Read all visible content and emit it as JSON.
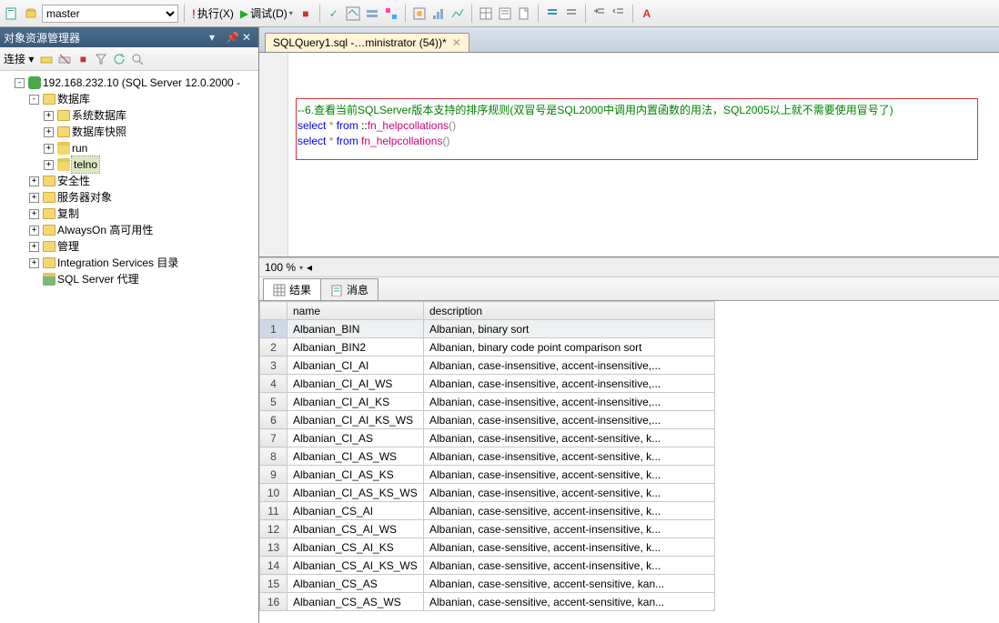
{
  "toolbar": {
    "db_selected": "master",
    "execute": "执行(X)",
    "debug": "调试(D)"
  },
  "sidebar": {
    "title": "对象资源管理器",
    "connect_label": "连接 ▾",
    "server": "192.168.232.10 (SQL Server 12.0.2000 -",
    "nodes": {
      "databases": "数据库",
      "sys_db": "系统数据库",
      "db_snap": "数据库快照",
      "run": "run",
      "telno": "telno",
      "security": "安全性",
      "server_obj": "服务器对象",
      "replication": "复制",
      "alwayson": "AlwaysOn 高可用性",
      "manage": "管理",
      "isc": "Integration Services 目录",
      "agent": "SQL Server 代理"
    }
  },
  "tab": {
    "label": "SQLQuery1.sql -…ministrator (54))*"
  },
  "code": {
    "l1": "--6.查看当前SQLServer版本支持的排序规则(双冒号是SQL2000中调用内置函数的用法，SQL2005以上就不需要使用冒号了)",
    "l2a": "select",
    "l2b": " * ",
    "l2c": "from",
    "l2d": " ::",
    "l2e": "fn_helpcollations",
    "l2f": "()",
    "l3a": "select",
    "l3b": " * ",
    "l3c": "from",
    "l3d": " ",
    "l3e": "fn_helpcollations",
    "l3f": "()"
  },
  "zoom": "100 %",
  "result_tabs": {
    "results": "结果",
    "messages": "消息"
  },
  "grid": {
    "cols": [
      "name",
      "description"
    ],
    "rows": [
      {
        "n": "Albanian_BIN",
        "d": "Albanian, binary sort"
      },
      {
        "n": "Albanian_BIN2",
        "d": "Albanian, binary code point comparison sort"
      },
      {
        "n": "Albanian_CI_AI",
        "d": "Albanian, case-insensitive, accent-insensitive,..."
      },
      {
        "n": "Albanian_CI_AI_WS",
        "d": "Albanian, case-insensitive, accent-insensitive,..."
      },
      {
        "n": "Albanian_CI_AI_KS",
        "d": "Albanian, case-insensitive, accent-insensitive,..."
      },
      {
        "n": "Albanian_CI_AI_KS_WS",
        "d": "Albanian, case-insensitive, accent-insensitive,..."
      },
      {
        "n": "Albanian_CI_AS",
        "d": "Albanian, case-insensitive, accent-sensitive, k..."
      },
      {
        "n": "Albanian_CI_AS_WS",
        "d": "Albanian, case-insensitive, accent-sensitive, k..."
      },
      {
        "n": "Albanian_CI_AS_KS",
        "d": "Albanian, case-insensitive, accent-sensitive, k..."
      },
      {
        "n": "Albanian_CI_AS_KS_WS",
        "d": "Albanian, case-insensitive, accent-sensitive, k..."
      },
      {
        "n": "Albanian_CS_AI",
        "d": "Albanian, case-sensitive, accent-insensitive, k..."
      },
      {
        "n": "Albanian_CS_AI_WS",
        "d": "Albanian, case-sensitive, accent-insensitive, k..."
      },
      {
        "n": "Albanian_CS_AI_KS",
        "d": "Albanian, case-sensitive, accent-insensitive, k..."
      },
      {
        "n": "Albanian_CS_AI_KS_WS",
        "d": "Albanian, case-sensitive, accent-insensitive, k..."
      },
      {
        "n": "Albanian_CS_AS",
        "d": "Albanian, case-sensitive, accent-sensitive, kan..."
      },
      {
        "n": "Albanian_CS_AS_WS",
        "d": "Albanian, case-sensitive, accent-sensitive, kan..."
      }
    ]
  }
}
